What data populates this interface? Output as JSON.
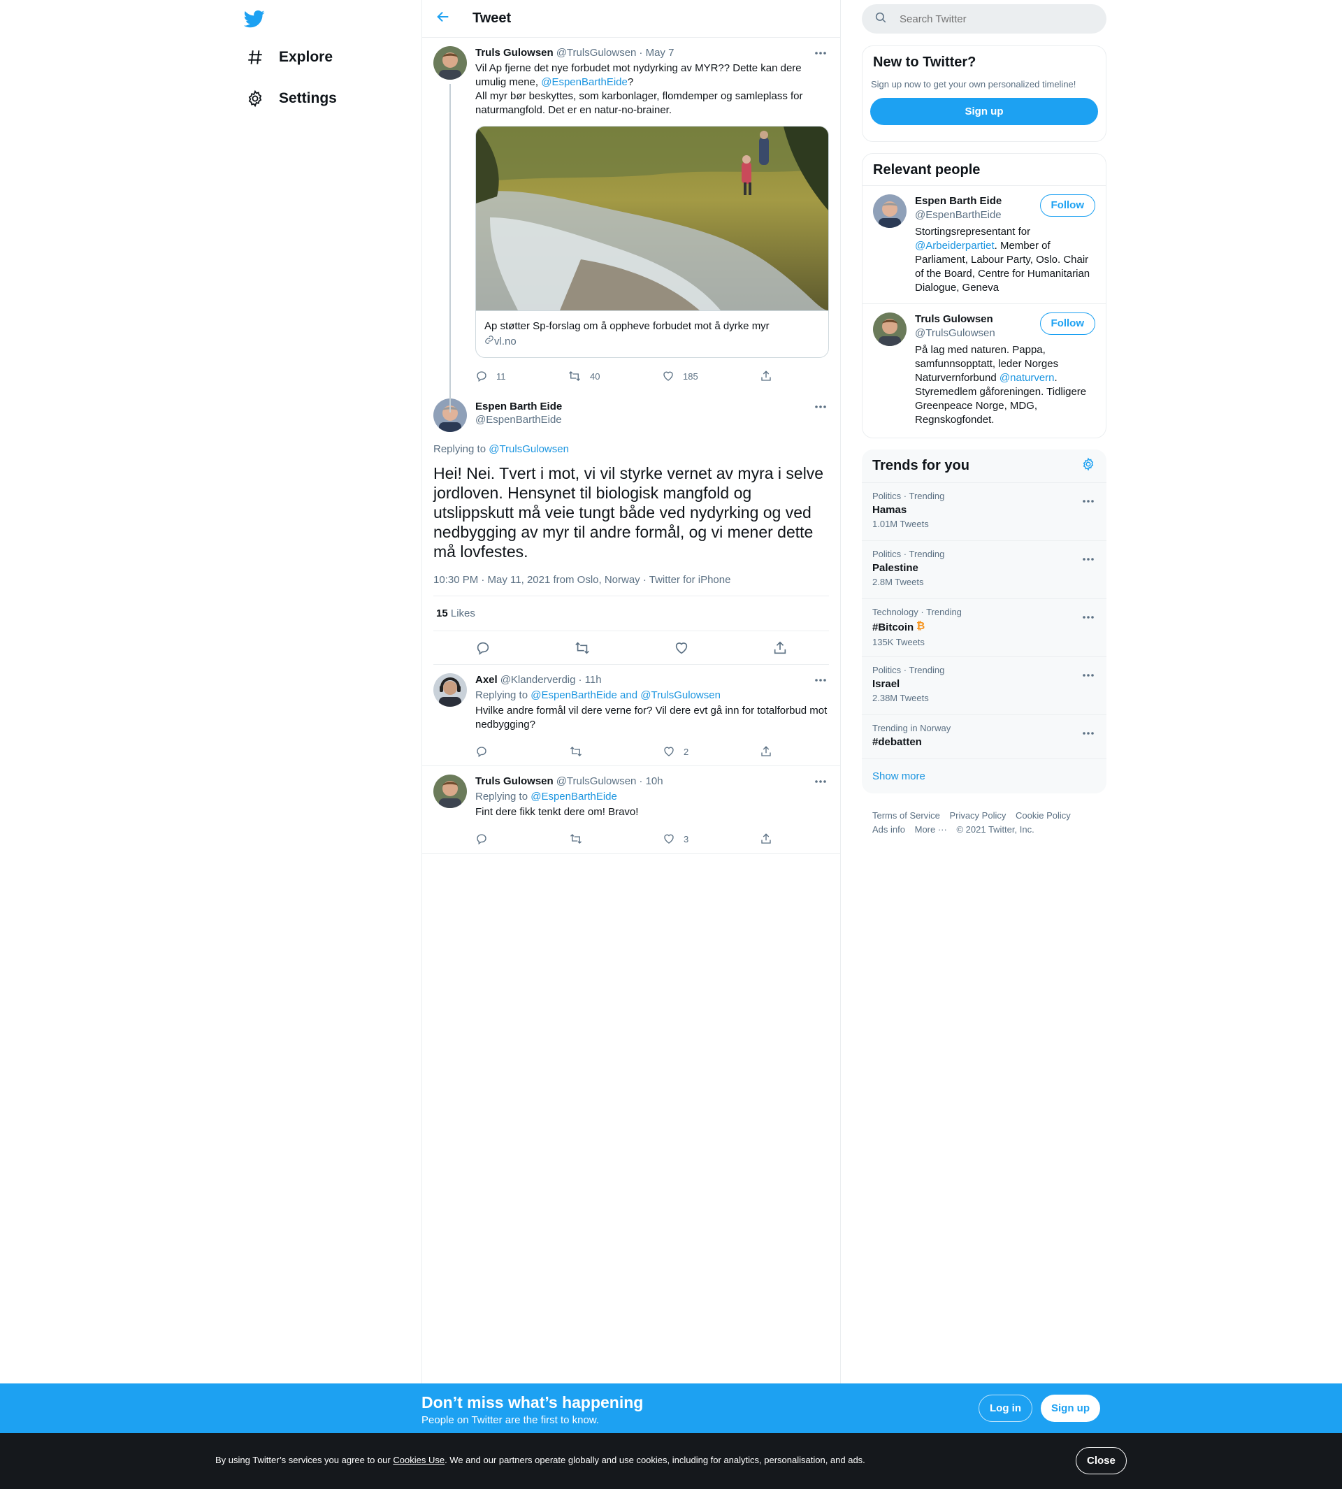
{
  "nav": {
    "logo": "twitter-bird-icon",
    "items": [
      {
        "label": "Explore",
        "icon": "hashtag-icon"
      },
      {
        "label": "Settings",
        "icon": "gear-icon"
      }
    ]
  },
  "header": {
    "title": "Tweet"
  },
  "parent_tweet": {
    "name": "Truls Gulowsen",
    "handle": "@TrulsGulowsen",
    "time": "· May 7",
    "text_1": "Vil Ap fjerne det nye forbudet mot nydyrking av MYR?? Dette kan dere umulig mene, ",
    "mention": "@EspenBarthEide",
    "text_2": "?",
    "text_3": "All myr bør beskyttes, som karbonlager, flomdemper og samleplass for naturmangfold. Det er en natur-no-brainer.",
    "card": {
      "title": "Ap støtter Sp-forslag om å oppheve forbudet mot å dyrke myr",
      "domain": "vl.no"
    },
    "replies": "11",
    "retweets": "40",
    "likes": "185"
  },
  "focal_tweet": {
    "name": "Espen Barth Eide",
    "handle": "@EspenBarthEide",
    "replying_label": "Replying to ",
    "replying_to": "@TrulsGulowsen",
    "text": "Hei! Nei. Tvert i mot, vi vil styrke vernet av myra i selve jordloven. Hensynet til biologisk mangfold og utslippskutt må veie tungt både ved nydyrking og ved nedbygging av myr til andre formål, og vi mener dette må lovfestes.",
    "meta": "10:30 PM · May 11, 2021 from Oslo, Norway · Twitter for iPhone",
    "likes_count": "15",
    "likes_label": " Likes"
  },
  "replies": [
    {
      "name": "Axel",
      "handle": "@Klanderverdig",
      "time": "· 11h",
      "replying_label": "Replying to ",
      "replying_to": "@EspenBarthEide and @TrulsGulowsen",
      "text": "Hvilke andre formål vil dere verne for? Vil dere evt gå inn for totalforbud mot nedbygging?",
      "likes": "2"
    },
    {
      "name": "Truls Gulowsen",
      "handle": "@TrulsGulowsen",
      "time": "· 10h",
      "replying_label": "Replying to ",
      "replying_to": "@EspenBarthEide",
      "text": "Fint dere fikk tenkt dere om! Bravo!",
      "likes": "3"
    }
  ],
  "search": {
    "placeholder": "Search Twitter"
  },
  "signup_box": {
    "title": "New to Twitter?",
    "subtitle": "Sign up now to get your own personalized timeline!",
    "button": "Sign up"
  },
  "relevant": {
    "title": "Relevant people",
    "people": [
      {
        "name": "Espen Barth Eide",
        "handle": "@EspenBarthEide",
        "follow": "Follow",
        "bio_1": "Stortingsrepresentant for ",
        "bio_link": "@Arbeiderpartiet",
        "bio_2": ". Member of Parliament, Labour Party, Oslo. Chair of the Board, Centre for Humanitarian Dialogue, Geneva"
      },
      {
        "name": "Truls Gulowsen",
        "handle": "@TrulsGulowsen",
        "follow": "Follow",
        "bio_1": "På lag med naturen. Pappa, samfunnsopptatt, leder Norges Naturvernforbund ",
        "bio_link": "@naturvern",
        "bio_2": ". Styremedlem gåforeningen. Tidligere Greenpeace Norge, MDG, Regnskogfondet."
      }
    ]
  },
  "trends": {
    "title": "Trends for you",
    "items": [
      {
        "category": "Politics · Trending",
        "name": "Hamas",
        "count": "1.01M Tweets"
      },
      {
        "category": "Politics · Trending",
        "name": "Palestine",
        "count": "2.8M Tweets"
      },
      {
        "category": "Technology · Trending",
        "name": "#Bitcoin",
        "count": "135K Tweets"
      },
      {
        "category": "Politics · Trending",
        "name": "Israel",
        "count": "2.38M Tweets"
      },
      {
        "category": "Trending in Norway",
        "name": "#debatten",
        "count": ""
      }
    ],
    "show_more": "Show more"
  },
  "footer": {
    "terms": "Terms of Service",
    "privacy": "Privacy Policy",
    "cookie": "Cookie Policy",
    "ads": "Ads info",
    "more": "More ···",
    "copyright": "© 2021 Twitter, Inc."
  },
  "bottom_bar": {
    "title": "Don’t miss what’s happening",
    "subtitle": "People on Twitter are the first to know.",
    "login": "Log in",
    "signup": "Sign up"
  },
  "cookie_bar": {
    "text_1": "By using Twitter’s services you agree to our ",
    "link": "Cookies Use",
    "text_2": ". We and our partners operate globally and use cookies, including for analytics, personalisation, and ads.",
    "close": "Close"
  },
  "colors": {
    "accent": "#1da1f2",
    "link": "#1b95e0",
    "muted": "#5b7083",
    "bitcoin": "#f7931a"
  }
}
